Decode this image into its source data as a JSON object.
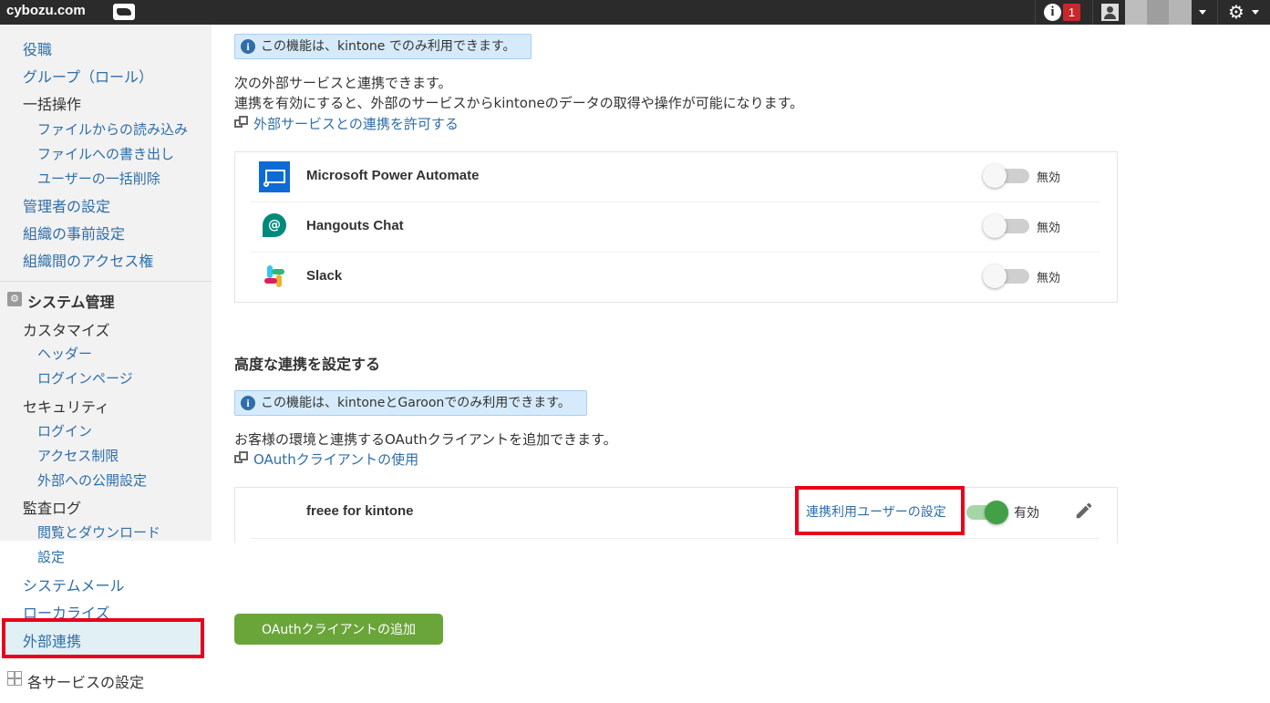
{
  "topbar": {
    "logo": "cybozu.com",
    "notification_count": "1"
  },
  "sidebar": {
    "items_top": [
      {
        "label": "役職",
        "level": 1
      },
      {
        "label": "グループ（ロール）",
        "level": 1
      },
      {
        "label": "一括操作",
        "level": 1
      },
      {
        "label": "ファイルからの読み込み",
        "level": 2
      },
      {
        "label": "ファイルへの書き出し",
        "level": 2
      },
      {
        "label": "ユーザーの一括削除",
        "level": 2
      },
      {
        "label": "管理者の設定",
        "level": 1
      },
      {
        "label": "組織の事前設定",
        "level": 1
      },
      {
        "label": "組織間のアクセス権",
        "level": 1
      }
    ],
    "system_section": "システム管理",
    "items_system": [
      {
        "label": "カスタマイズ",
        "level": 1
      },
      {
        "label": "ヘッダー",
        "level": 2
      },
      {
        "label": "ログインページ",
        "level": 2
      },
      {
        "label": "セキュリティ",
        "level": 1
      },
      {
        "label": "ログイン",
        "level": 2
      },
      {
        "label": "アクセス制限",
        "level": 2
      },
      {
        "label": "外部への公開設定",
        "level": 2
      },
      {
        "label": "監査ログ",
        "level": 1
      },
      {
        "label": "閲覧とダウンロード",
        "level": 2
      },
      {
        "label": "設定",
        "level": 2
      },
      {
        "label": "システムメール",
        "level": 1
      },
      {
        "label": "ローカライズ",
        "level": 1
      }
    ],
    "active_item": "外部連携",
    "services_section": "各サービスの設定"
  },
  "main": {
    "notice1": "この機能は、kintone でのみ利用できます。",
    "desc1_line1": "次の外部サービスと連携できます。",
    "desc1_line2": "連携を有効にすると、外部のサービスからkintoneのデータの取得や操作が可能になります。",
    "link1": "外部サービスとの連携を許可する",
    "services": [
      {
        "name": "Microsoft Power Automate",
        "status": "無効"
      },
      {
        "name": "Hangouts Chat",
        "status": "無効"
      },
      {
        "name": "Slack",
        "status": "無効"
      }
    ],
    "advanced_heading": "高度な連携を設定する",
    "notice2": "この機能は、kintoneとGaroonでのみ利用できます。",
    "desc2": "お客様の環境と連携するOAuthクライアントを追加できます。",
    "link2": "OAuthクライアントの使用",
    "oauth_client": {
      "name": "freee for kintone",
      "user_setting_link": "連携利用ユーザーの設定",
      "status": "有効"
    },
    "add_button": "OAuthクライアントの追加"
  },
  "colors": {
    "topbar": "#2b2b2b",
    "link": "#2f6ea8",
    "highlight": "#e8001c",
    "toggle_on": "#43a047",
    "button": "#6aa53a"
  }
}
